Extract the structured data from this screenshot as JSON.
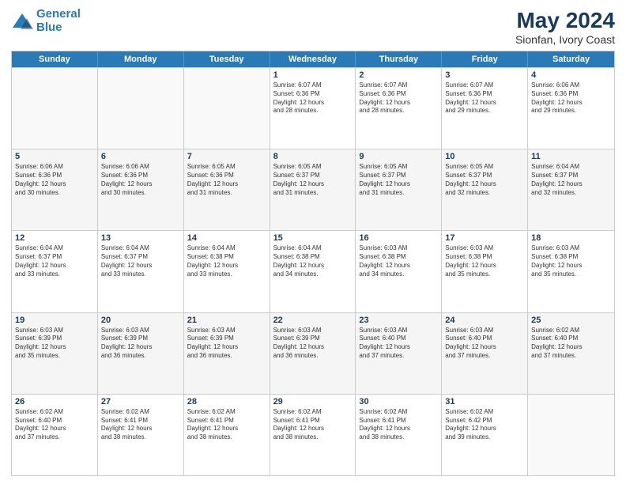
{
  "logo": {
    "line1": "General",
    "line2": "Blue"
  },
  "title": "May 2024",
  "subtitle": "Sionfan, Ivory Coast",
  "days": [
    "Sunday",
    "Monday",
    "Tuesday",
    "Wednesday",
    "Thursday",
    "Friday",
    "Saturday"
  ],
  "weeks": [
    [
      {
        "day": "",
        "info": ""
      },
      {
        "day": "",
        "info": ""
      },
      {
        "day": "",
        "info": ""
      },
      {
        "day": "1",
        "info": "Sunrise: 6:07 AM\nSunset: 6:36 PM\nDaylight: 12 hours\nand 28 minutes."
      },
      {
        "day": "2",
        "info": "Sunrise: 6:07 AM\nSunset: 6:36 PM\nDaylight: 12 hours\nand 28 minutes."
      },
      {
        "day": "3",
        "info": "Sunrise: 6:07 AM\nSunset: 6:36 PM\nDaylight: 12 hours\nand 29 minutes."
      },
      {
        "day": "4",
        "info": "Sunrise: 6:06 AM\nSunset: 6:36 PM\nDaylight: 12 hours\nand 29 minutes."
      }
    ],
    [
      {
        "day": "5",
        "info": "Sunrise: 6:06 AM\nSunset: 6:36 PM\nDaylight: 12 hours\nand 30 minutes."
      },
      {
        "day": "6",
        "info": "Sunrise: 6:06 AM\nSunset: 6:36 PM\nDaylight: 12 hours\nand 30 minutes."
      },
      {
        "day": "7",
        "info": "Sunrise: 6:05 AM\nSunset: 6:36 PM\nDaylight: 12 hours\nand 31 minutes."
      },
      {
        "day": "8",
        "info": "Sunrise: 6:05 AM\nSunset: 6:37 PM\nDaylight: 12 hours\nand 31 minutes."
      },
      {
        "day": "9",
        "info": "Sunrise: 6:05 AM\nSunset: 6:37 PM\nDaylight: 12 hours\nand 31 minutes."
      },
      {
        "day": "10",
        "info": "Sunrise: 6:05 AM\nSunset: 6:37 PM\nDaylight: 12 hours\nand 32 minutes."
      },
      {
        "day": "11",
        "info": "Sunrise: 6:04 AM\nSunset: 6:37 PM\nDaylight: 12 hours\nand 32 minutes."
      }
    ],
    [
      {
        "day": "12",
        "info": "Sunrise: 6:04 AM\nSunset: 6:37 PM\nDaylight: 12 hours\nand 33 minutes."
      },
      {
        "day": "13",
        "info": "Sunrise: 6:04 AM\nSunset: 6:37 PM\nDaylight: 12 hours\nand 33 minutes."
      },
      {
        "day": "14",
        "info": "Sunrise: 6:04 AM\nSunset: 6:38 PM\nDaylight: 12 hours\nand 33 minutes."
      },
      {
        "day": "15",
        "info": "Sunrise: 6:04 AM\nSunset: 6:38 PM\nDaylight: 12 hours\nand 34 minutes."
      },
      {
        "day": "16",
        "info": "Sunrise: 6:03 AM\nSunset: 6:38 PM\nDaylight: 12 hours\nand 34 minutes."
      },
      {
        "day": "17",
        "info": "Sunrise: 6:03 AM\nSunset: 6:38 PM\nDaylight: 12 hours\nand 35 minutes."
      },
      {
        "day": "18",
        "info": "Sunrise: 6:03 AM\nSunset: 6:38 PM\nDaylight: 12 hours\nand 35 minutes."
      }
    ],
    [
      {
        "day": "19",
        "info": "Sunrise: 6:03 AM\nSunset: 6:39 PM\nDaylight: 12 hours\nand 35 minutes."
      },
      {
        "day": "20",
        "info": "Sunrise: 6:03 AM\nSunset: 6:39 PM\nDaylight: 12 hours\nand 36 minutes."
      },
      {
        "day": "21",
        "info": "Sunrise: 6:03 AM\nSunset: 6:39 PM\nDaylight: 12 hours\nand 36 minutes."
      },
      {
        "day": "22",
        "info": "Sunrise: 6:03 AM\nSunset: 6:39 PM\nDaylight: 12 hours\nand 36 minutes."
      },
      {
        "day": "23",
        "info": "Sunrise: 6:03 AM\nSunset: 6:40 PM\nDaylight: 12 hours\nand 37 minutes."
      },
      {
        "day": "24",
        "info": "Sunrise: 6:03 AM\nSunset: 6:40 PM\nDaylight: 12 hours\nand 37 minutes."
      },
      {
        "day": "25",
        "info": "Sunrise: 6:02 AM\nSunset: 6:40 PM\nDaylight: 12 hours\nand 37 minutes."
      }
    ],
    [
      {
        "day": "26",
        "info": "Sunrise: 6:02 AM\nSunset: 6:40 PM\nDaylight: 12 hours\nand 37 minutes."
      },
      {
        "day": "27",
        "info": "Sunrise: 6:02 AM\nSunset: 6:41 PM\nDaylight: 12 hours\nand 38 minutes."
      },
      {
        "day": "28",
        "info": "Sunrise: 6:02 AM\nSunset: 6:41 PM\nDaylight: 12 hours\nand 38 minutes."
      },
      {
        "day": "29",
        "info": "Sunrise: 6:02 AM\nSunset: 6:41 PM\nDaylight: 12 hours\nand 38 minutes."
      },
      {
        "day": "30",
        "info": "Sunrise: 6:02 AM\nSunset: 6:41 PM\nDaylight: 12 hours\nand 38 minutes."
      },
      {
        "day": "31",
        "info": "Sunrise: 6:02 AM\nSunset: 6:42 PM\nDaylight: 12 hours\nand 39 minutes."
      },
      {
        "day": "",
        "info": ""
      }
    ]
  ]
}
